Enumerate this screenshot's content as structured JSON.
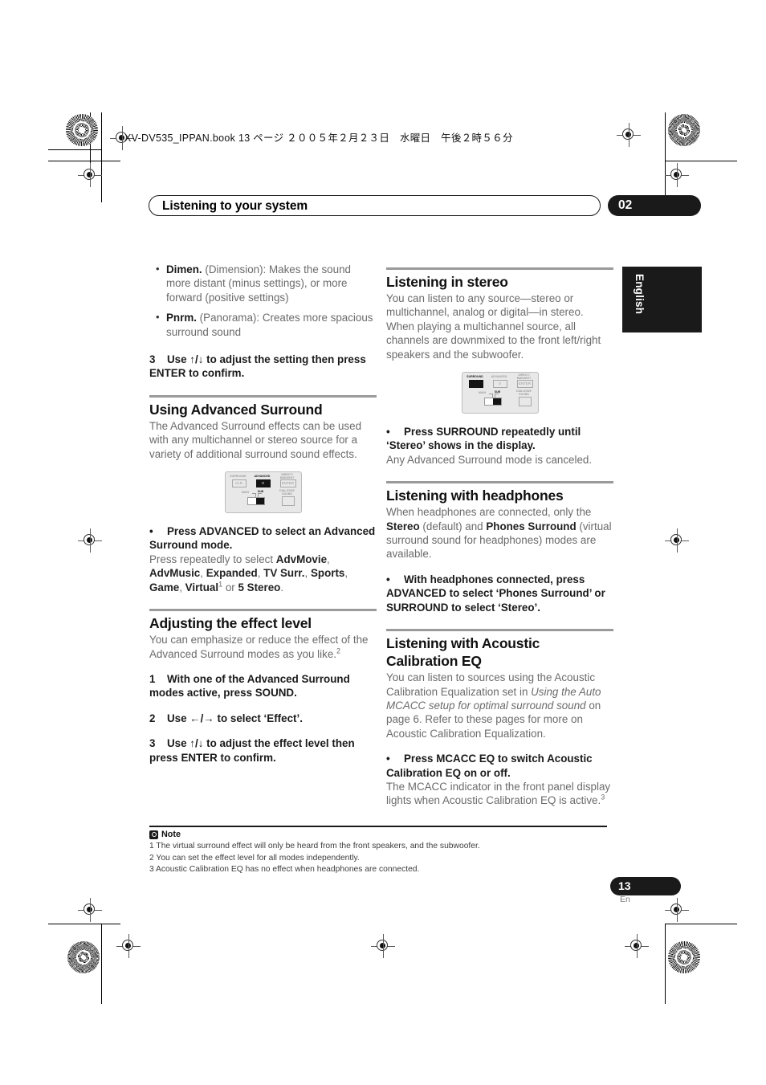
{
  "print_marks": {
    "file_header": "XV-DV535_IPPAN.book  13 ページ  ２００５年２月２３日　水曜日　午後２時５６分"
  },
  "running_head": {
    "title": "Listening to your system",
    "chapter_number": "02"
  },
  "language_tab": {
    "label": "English"
  },
  "left_column": {
    "bullets": [
      {
        "term": "Dimen.",
        "rest": " (Dimension): Makes the sound more distant (minus settings), or more forward (positive settings)"
      },
      {
        "term": "Pnrm.",
        "rest": " (Panorama): Creates more spacious surround sound"
      }
    ],
    "step3": {
      "num": "3",
      "text": "Use ↑/↓ to adjust the setting then press ENTER to confirm."
    },
    "section_advanced": {
      "heading": "Using Advanced Surround",
      "intro": "The Advanced Surround effects can be used with any multichannel or stereo source for a variety of additional surround sound effects.",
      "action_bold": "Press ADVANCED to select an Advanced Surround mode.",
      "follow_prefix": "Press repeatedly to select ",
      "modes": [
        "AdvMovie",
        "AdvMusic",
        "Expanded",
        "TV Surr.",
        "Sports",
        "Game",
        "Virtual",
        "5 Stereo"
      ],
      "follow_or": " or ",
      "virtual_footnote": "1"
    },
    "section_effect": {
      "heading": "Adjusting the effect level",
      "intro": "You can emphasize or reduce the effect of the Advanced Surround modes as you like.",
      "intro_footnote": "2",
      "steps": [
        {
          "num": "1",
          "text": "With one of the Advanced Surround modes active, press SOUND."
        },
        {
          "num": "2",
          "text": "Use ←/→ to select ‘Effect’."
        },
        {
          "num": "3",
          "text": "Use ↑/↓ to adjust the effect level then press ENTER to confirm."
        }
      ]
    }
  },
  "right_column": {
    "section_stereo": {
      "heading": "Listening in stereo",
      "intro": "You can listen to any source—stereo or multichannel, analog or digital—in stereo. When playing a multichannel source, all channels are downmixed to the front left/right speakers and the subwoofer.",
      "action_bold": "Press SURROUND repeatedly until ‘Stereo’ shows in the display.",
      "action_follow": "Any Advanced Surround mode is canceled."
    },
    "section_headphones": {
      "heading": "Listening with headphones",
      "intro_1": "When headphones are connected, only the ",
      "intro_b1": "Stereo",
      "intro_2": " (default) and ",
      "intro_b2": "Phones Surround",
      "intro_3": " (virtual surround sound for headphones) modes are available.",
      "action_bold": "With headphones connected, press ADVANCED to select ‘Phones Surround’ or SURROUND to select ‘Stereo’."
    },
    "section_mcacc": {
      "heading_line1": "Listening with Acoustic",
      "heading_line2": "Calibration EQ",
      "intro_1": "You can listen to sources using the Acoustic Calibration Equalization set in ",
      "intro_italic": "Using the Auto MCACC setup for optimal surround sound",
      "intro_2": " on page 6. Refer to these pages for more on Acoustic Calibration Equalization.",
      "action_bold": "Press MCACC EQ to switch Acoustic Calibration EQ on or off.",
      "action_follow": "The MCACC indicator in the front panel display lights when Acoustic Calibration EQ is active.",
      "action_footnote": "3"
    }
  },
  "remote_advanced": {
    "caption": "remote control detail, ADVANCED button highlighted",
    "labels": {
      "surround": "SURROUND",
      "advanced": "ADVANCED",
      "midnight_top": "DIRECT/",
      "midnight": "MIDNIGHT",
      "clr": "CLR",
      "enter": "ENTER",
      "dialogue": "DIALOGUE",
      "sound": "SOUND",
      "main": "MAIN",
      "sub": "SUB"
    },
    "highlight": "advanced"
  },
  "remote_surround": {
    "caption": "remote control detail, SURROUND button highlighted",
    "labels": {
      "surround": "SURROUND",
      "advanced": "ADVANCED",
      "midnight_top": "DIRECT/",
      "midnight": "MIDNIGHT",
      "clr": "CLR",
      "enter": "ENTER",
      "dialogue": "DIALOGUE",
      "sound": "SOUND",
      "main": "MAIN",
      "sub": "SUB"
    },
    "highlight": "surround"
  },
  "notes": {
    "heading": "Note",
    "items": [
      "1 The virtual surround effect will only be heard from the front speakers, and the subwoofer.",
      "2 You can set the effect level for all modes independently.",
      "3 Acoustic Calibration EQ has no effect when headphones are connected."
    ]
  },
  "folio": {
    "page": "13",
    "lang": "En"
  }
}
